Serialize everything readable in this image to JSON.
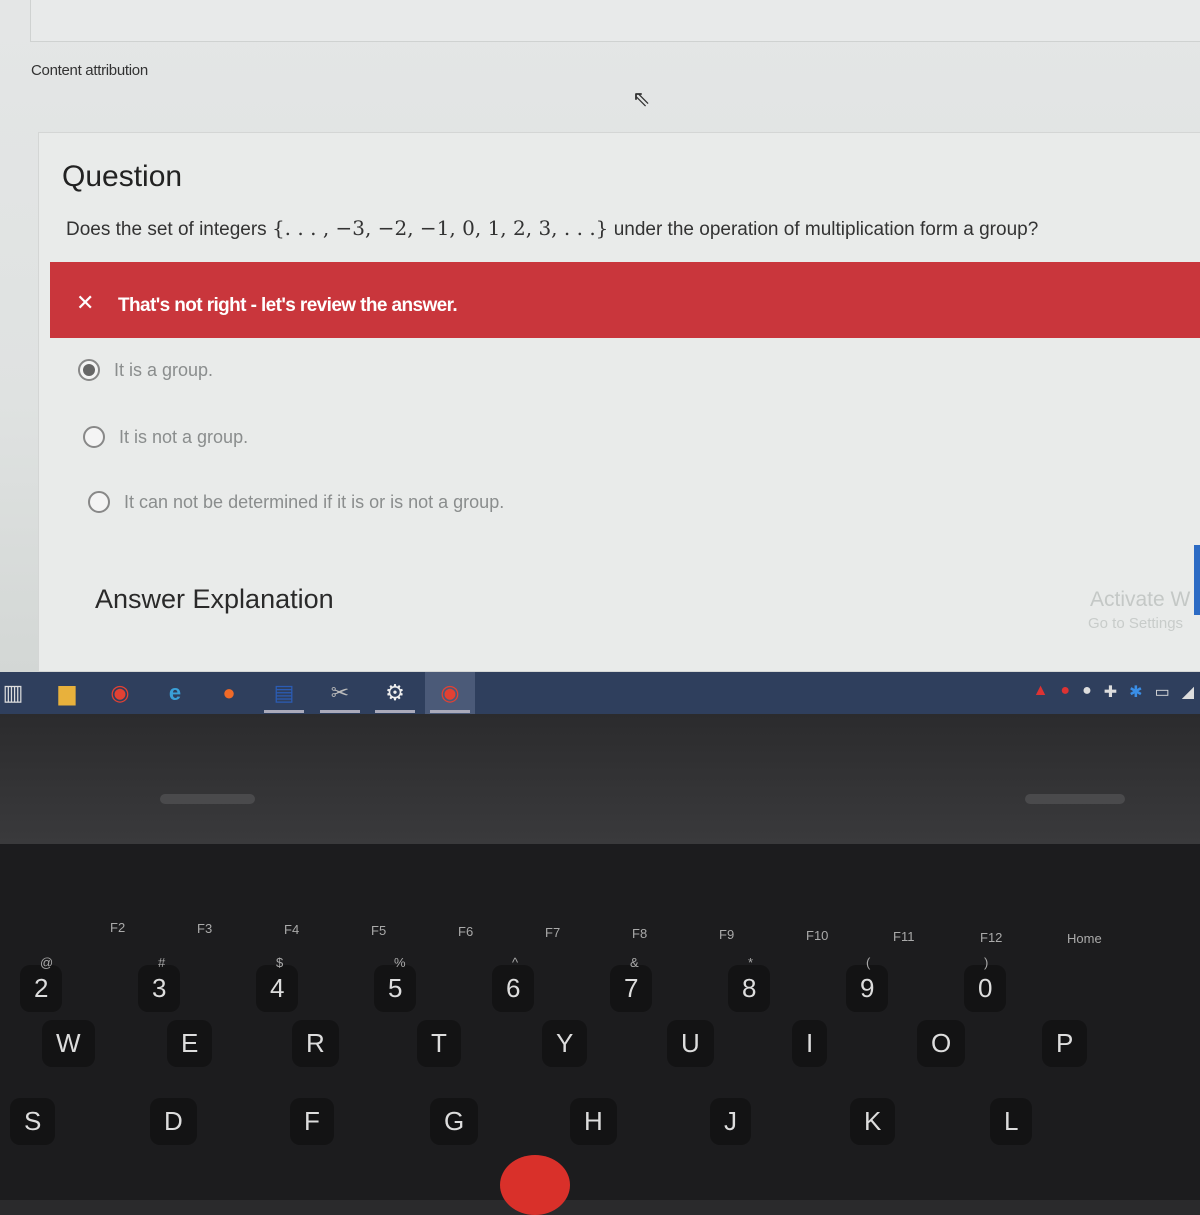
{
  "page": {
    "content_attribution": "Content attribution"
  },
  "question": {
    "heading": "Question",
    "text_before": "Does the set of integers",
    "math": "{. . . , −3, −2, −1, 0, 1, 2, 3, . . .}",
    "text_after": "under the operation of multiplication form a group?"
  },
  "feedback": {
    "icon": "close-icon",
    "message": "That's not right - let's review the answer.",
    "color": "#c9363c"
  },
  "options": [
    {
      "label": "It is a group.",
      "selected": true
    },
    {
      "label": "It is not a group.",
      "selected": false
    },
    {
      "label": "It can not be determined if it is or is not a group.",
      "selected": false
    }
  ],
  "explanation": {
    "heading": "Answer Explanation"
  },
  "watermark": {
    "line1": "Activate W",
    "line2": "Go to Settings"
  },
  "taskbar": {
    "icons": [
      "task-view-icon",
      "file-explorer-icon",
      "chrome-icon",
      "internet-explorer-icon",
      "firefox-icon",
      "word-icon",
      "snipping-tool-icon",
      "settings-icon",
      "chrome-profile-icon"
    ],
    "tray": [
      "acrobat-icon",
      "app-icon",
      "circle-icon",
      "network-icon",
      "bluetooth-icon",
      "battery-icon",
      "wifi-icon"
    ]
  },
  "keyboard": {
    "fn_keys": [
      "F2",
      "F3",
      "F4",
      "F5",
      "F6",
      "F7",
      "F8",
      "F9",
      "F10",
      "F11",
      "F12",
      "Home"
    ],
    "num_row": [
      "2",
      "3",
      "4",
      "5",
      "6",
      "7",
      "8",
      "9",
      "0"
    ],
    "num_shift": [
      "@",
      "#",
      "$",
      "%",
      "^",
      "&",
      "*",
      "(",
      ")"
    ],
    "top_row": [
      "W",
      "E",
      "R",
      "T",
      "Y",
      "U",
      "I",
      "O",
      "P"
    ],
    "home_row": [
      "S",
      "D",
      "F",
      "G",
      "H",
      "J",
      "K",
      "L"
    ]
  }
}
